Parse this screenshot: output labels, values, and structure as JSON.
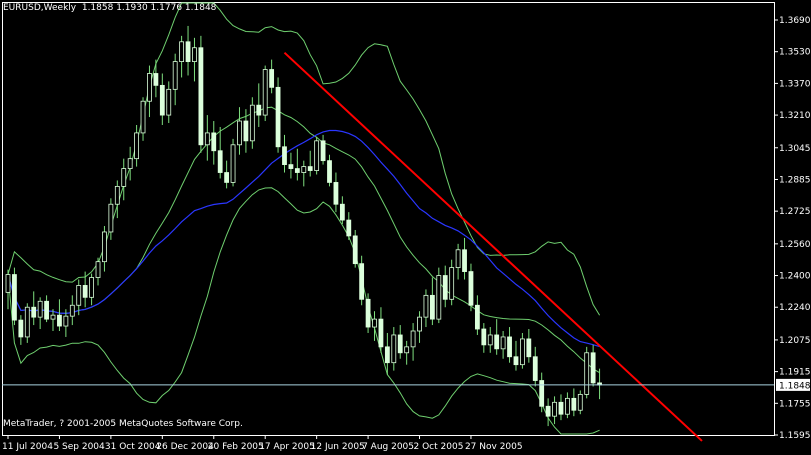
{
  "header": {
    "symbol": "EURUSD,Weekly",
    "quote": "1.1858 1.1930 1.1776 1.1848"
  },
  "copyright": "MetaTrader, ? 2001-2005 MetaQuotes Software Corp.",
  "colors": {
    "background": "#000000",
    "frame": "#ffffff",
    "candle_fill": "#dcffdc",
    "wick": "#7fdf7f",
    "bollinger": "#6fcf6f",
    "moving_average": "#2a36ff",
    "trendline": "#ff0000",
    "price_line": "#a9d3e0"
  },
  "chart_data": {
    "type": "candlestick",
    "ylim": [
      1.1595,
      1.369
    ],
    "y_ticks": [
      "1.3690",
      "1.3530",
      "1.3370",
      "1.3210",
      "1.3045",
      "1.2885",
      "1.2725",
      "1.2560",
      "1.2400",
      "1.2240",
      "1.2075",
      "1.1915",
      "1.1755",
      "1.1595"
    ],
    "x_ticks": [
      "11 Jul 2004",
      "5 Sep 2004",
      "31 Oct 2004",
      "26 Dec 2004",
      "20 Feb 2005",
      "17 Apr 2005",
      "12 Jun 2005",
      "7 Aug 2005",
      "2 Oct 2005",
      "27 Nov 2005"
    ],
    "current_price": "1.1848",
    "candles": [
      [
        1.2315,
        1.243,
        1.223,
        1.2405
      ],
      [
        1.2405,
        1.244,
        1.215,
        1.2175
      ],
      [
        1.2175,
        1.22,
        1.205,
        1.209
      ],
      [
        1.209,
        1.226,
        1.206,
        1.224
      ],
      [
        1.224,
        1.232,
        1.215,
        1.219
      ],
      [
        1.219,
        1.229,
        1.213,
        1.227
      ],
      [
        1.227,
        1.23,
        1.2165,
        1.218
      ],
      [
        1.218,
        1.223,
        1.212,
        1.22
      ],
      [
        1.22,
        1.228,
        1.212,
        1.2145
      ],
      [
        1.2145,
        1.223,
        1.209,
        1.2195
      ],
      [
        1.2195,
        1.23,
        1.215,
        1.225
      ],
      [
        1.225,
        1.238,
        1.22,
        1.235
      ],
      [
        1.235,
        1.242,
        1.224,
        1.229
      ],
      [
        1.229,
        1.241,
        1.225,
        1.239
      ],
      [
        1.239,
        1.249,
        1.235,
        1.247
      ],
      [
        1.247,
        1.265,
        1.242,
        1.262
      ],
      [
        1.262,
        1.279,
        1.258,
        1.276
      ],
      [
        1.276,
        1.288,
        1.269,
        1.285
      ],
      [
        1.285,
        1.299,
        1.278,
        1.294
      ],
      [
        1.294,
        1.305,
        1.288,
        1.299
      ],
      [
        1.299,
        1.316,
        1.295,
        1.312
      ],
      [
        1.312,
        1.33,
        1.308,
        1.328
      ],
      [
        1.328,
        1.346,
        1.32,
        1.342
      ],
      [
        1.342,
        1.349,
        1.33,
        1.336
      ],
      [
        1.336,
        1.342,
        1.316,
        1.321
      ],
      [
        1.321,
        1.338,
        1.317,
        1.334
      ],
      [
        1.334,
        1.352,
        1.326,
        1.348
      ],
      [
        1.348,
        1.361,
        1.34,
        1.358
      ],
      [
        1.358,
        1.366,
        1.341,
        1.348
      ],
      [
        1.348,
        1.36,
        1.338,
        1.355
      ],
      [
        1.355,
        1.361,
        1.302,
        1.306
      ],
      [
        1.306,
        1.321,
        1.298,
        1.312
      ],
      [
        1.312,
        1.318,
        1.296,
        1.303
      ],
      [
        1.303,
        1.315,
        1.289,
        1.292
      ],
      [
        1.292,
        1.298,
        1.284,
        1.287
      ],
      [
        1.287,
        1.309,
        1.285,
        1.306
      ],
      [
        1.306,
        1.325,
        1.301,
        1.318
      ],
      [
        1.318,
        1.324,
        1.302,
        1.308
      ],
      [
        1.308,
        1.33,
        1.304,
        1.326
      ],
      [
        1.326,
        1.337,
        1.315,
        1.321
      ],
      [
        1.321,
        1.346,
        1.318,
        1.344
      ],
      [
        1.344,
        1.349,
        1.332,
        1.335
      ],
      [
        1.335,
        1.34,
        1.302,
        1.305
      ],
      [
        1.305,
        1.311,
        1.292,
        1.296
      ],
      [
        1.296,
        1.302,
        1.289,
        1.294
      ],
      [
        1.294,
        1.304,
        1.288,
        1.292
      ],
      [
        1.292,
        1.298,
        1.285,
        1.295
      ],
      [
        1.295,
        1.303,
        1.29,
        1.293
      ],
      [
        1.293,
        1.31,
        1.291,
        1.308
      ],
      [
        1.308,
        1.311,
        1.296,
        1.298
      ],
      [
        1.298,
        1.301,
        1.285,
        1.287
      ],
      [
        1.287,
        1.292,
        1.272,
        1.276
      ],
      [
        1.276,
        1.28,
        1.266,
        1.268
      ],
      [
        1.268,
        1.272,
        1.258,
        1.26
      ],
      [
        1.26,
        1.263,
        1.244,
        1.246
      ],
      [
        1.246,
        1.25,
        1.225,
        1.228
      ],
      [
        1.228,
        1.231,
        1.211,
        1.214
      ],
      [
        1.214,
        1.222,
        1.207,
        1.218
      ],
      [
        1.218,
        1.224,
        1.201,
        1.204
      ],
      [
        1.204,
        1.211,
        1.19,
        1.196
      ],
      [
        1.196,
        1.214,
        1.192,
        1.21
      ],
      [
        1.21,
        1.215,
        1.198,
        1.201
      ],
      [
        1.201,
        1.207,
        1.195,
        1.204
      ],
      [
        1.204,
        1.216,
        1.197,
        1.212
      ],
      [
        1.212,
        1.222,
        1.206,
        1.219
      ],
      [
        1.219,
        1.233,
        1.214,
        1.23
      ],
      [
        1.23,
        1.239,
        1.215,
        1.218
      ],
      [
        1.218,
        1.244,
        1.216,
        1.24
      ],
      [
        1.24,
        1.245,
        1.224,
        1.228
      ],
      [
        1.228,
        1.248,
        1.225,
        1.244
      ],
      [
        1.244,
        1.256,
        1.238,
        1.253
      ],
      [
        1.253,
        1.259,
        1.238,
        1.242
      ],
      [
        1.242,
        1.246,
        1.222,
        1.225
      ],
      [
        1.225,
        1.23,
        1.21,
        1.213
      ],
      [
        1.213,
        1.216,
        1.201,
        1.205
      ],
      [
        1.205,
        1.214,
        1.201,
        1.21
      ],
      [
        1.21,
        1.218,
        1.2,
        1.203
      ],
      [
        1.203,
        1.212,
        1.198,
        1.209
      ],
      [
        1.209,
        1.214,
        1.196,
        1.199
      ],
      [
        1.199,
        1.207,
        1.192,
        1.195
      ],
      [
        1.195,
        1.211,
        1.193,
        1.208
      ],
      [
        1.208,
        1.213,
        1.196,
        1.199
      ],
      [
        1.199,
        1.204,
        1.184,
        1.187
      ],
      [
        1.187,
        1.191,
        1.171,
        1.174
      ],
      [
        1.174,
        1.178,
        1.164,
        1.169
      ],
      [
        1.169,
        1.179,
        1.165,
        1.176
      ],
      [
        1.176,
        1.18,
        1.167,
        1.17
      ],
      [
        1.17,
        1.181,
        1.168,
        1.178
      ],
      [
        1.178,
        1.183,
        1.169,
        1.172
      ],
      [
        1.172,
        1.182,
        1.17,
        1.18
      ],
      [
        1.18,
        1.204,
        1.178,
        1.201
      ],
      [
        1.201,
        1.205,
        1.184,
        1.1858
      ],
      [
        1.1858,
        1.193,
        1.1776,
        1.1848
      ]
    ]
  }
}
